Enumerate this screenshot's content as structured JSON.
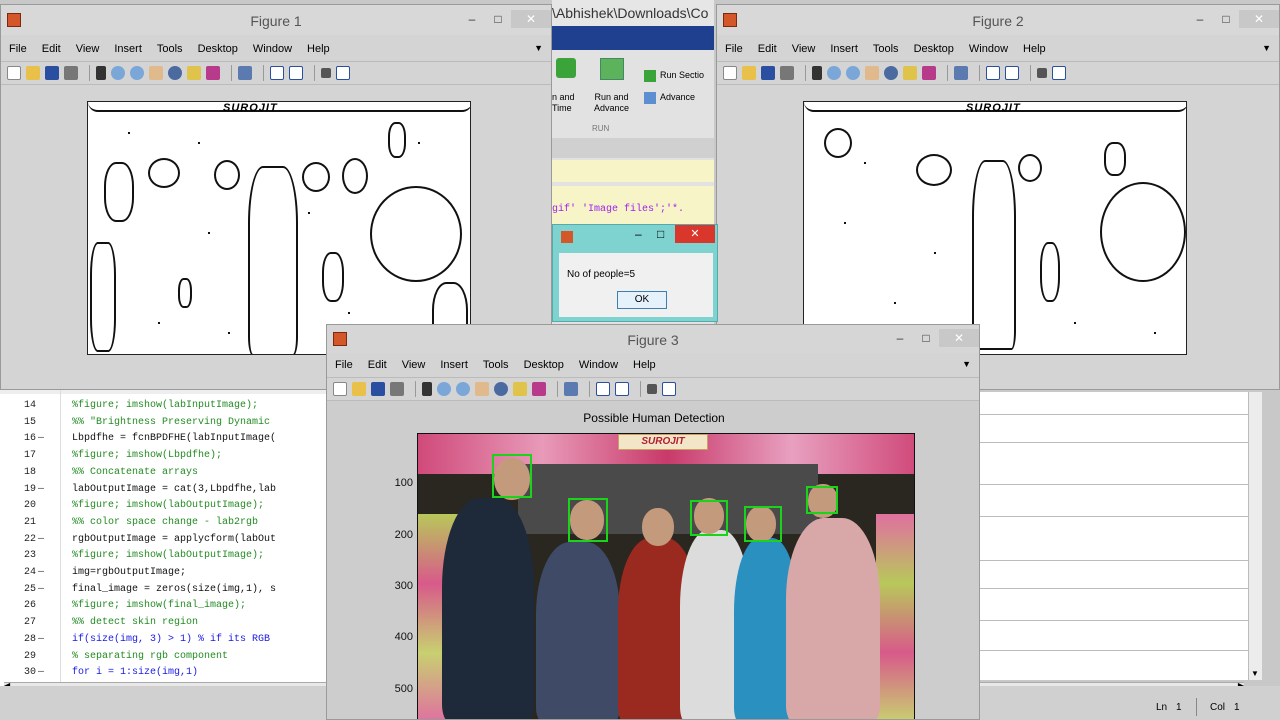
{
  "figure1": {
    "title": "Figure 1",
    "banner": "SUROJIT",
    "menu": [
      "File",
      "Edit",
      "View",
      "Insert",
      "Tools",
      "Desktop",
      "Window",
      "Help"
    ]
  },
  "figure2": {
    "title": "Figure 2",
    "banner": "SUROJIT",
    "menu": [
      "File",
      "Edit",
      "View",
      "Insert",
      "Tools",
      "Desktop",
      "Window",
      "Help"
    ]
  },
  "figure3": {
    "title": "Figure 3",
    "menu": [
      "File",
      "Edit",
      "View",
      "Insert",
      "Tools",
      "Desktop",
      "Window",
      "Help"
    ],
    "axes_title": "Possible Human Detection",
    "banner": "SUROJIT",
    "yticks": [
      "100",
      "200",
      "300",
      "400",
      "500"
    ]
  },
  "matlab": {
    "path_title": "\\Abhishek\\Downloads\\Co",
    "ribbon": {
      "run_and_time": "n and\nTime",
      "run_and_advance": "Run and\nAdvance",
      "run_section": "Run Sectio",
      "advance": "Advance",
      "group_label": "RUN"
    },
    "editor_snippet": "gif' 'Image files';'*."
  },
  "dialog": {
    "message": "No of people=5",
    "ok_label": "OK"
  },
  "editor": {
    "lines": [
      {
        "n": "14",
        "m": "",
        "t": "%figure; imshow(labInputImage);",
        "c": "green"
      },
      {
        "n": "15",
        "m": "",
        "t": "%% \"Brightness Preserving Dynamic",
        "c": "green"
      },
      {
        "n": "16",
        "m": "—",
        "t": "Lbpdfhe = fcnBPDFHE(labInputImage(",
        "c": "black"
      },
      {
        "n": "17",
        "m": "",
        "t": "%figure; imshow(Lbpdfhe);",
        "c": "green"
      },
      {
        "n": "18",
        "m": "",
        "t": "%% Concatenate arrays",
        "c": "green"
      },
      {
        "n": "19",
        "m": "—",
        "t": "labOutputImage = cat(3,Lbpdfhe,lab",
        "c": "black"
      },
      {
        "n": "20",
        "m": "",
        "t": "%figure; imshow(labOutputImage);",
        "c": "green"
      },
      {
        "n": "21",
        "m": "",
        "t": "%% color space change - lab2rgb",
        "c": "green"
      },
      {
        "n": "22",
        "m": "—",
        "t": "rgbOutputImage = applycform(labOut",
        "c": "black"
      },
      {
        "n": "23",
        "m": "",
        "t": "%figure; imshow(labOutputImage);",
        "c": "green"
      },
      {
        "n": "24",
        "m": "—",
        "t": "img=rgbOutputImage;",
        "c": "black"
      },
      {
        "n": "25",
        "m": "—",
        "t": "final_image = zeros(size(img,1), s",
        "c": "black"
      },
      {
        "n": "26",
        "m": "",
        "t": "%figure; imshow(final_image);",
        "c": "green"
      },
      {
        "n": "27",
        "m": "",
        "t": "%% detect skin region",
        "c": "green"
      },
      {
        "n": "28",
        "m": "—",
        "t": "if(size(img, 3) > 1) % if its RGB",
        "c": "blue"
      },
      {
        "n": "29",
        "m": "",
        "t": "% separating rgb component",
        "c": "green"
      },
      {
        "n": "30",
        "m": "—",
        "t": "for i = 1:size(img,1)",
        "c": "blue"
      }
    ]
  },
  "status": {
    "ln_label": "Ln",
    "ln_value": "1",
    "col_label": "Col",
    "col_value": "1"
  },
  "colors": {
    "face_box": "#19d419",
    "dialog_frame": "#7ed2d0",
    "close_red": "#d9362c"
  }
}
